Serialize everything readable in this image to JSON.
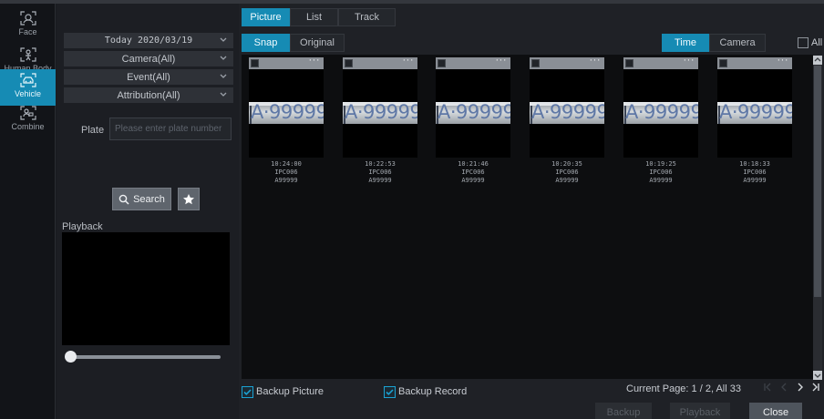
{
  "rail": [
    {
      "label": "Face",
      "icon": "face-scan-icon",
      "active": false
    },
    {
      "label": "Human Body",
      "icon": "human-body-icon",
      "active": false
    },
    {
      "label": "Vehicle",
      "icon": "vehicle-icon",
      "active": true
    },
    {
      "label": "Combine",
      "icon": "combine-icon",
      "active": false
    }
  ],
  "filters": {
    "date": "Today 2020/03/19",
    "camera": "Camera(All)",
    "event": "Event(All)",
    "attribution": "Attribution(All)",
    "plate_label": "Plate",
    "plate_placeholder": "Please enter plate number",
    "search_label": "Search",
    "playback_label": "Playback"
  },
  "tabs": [
    "Picture",
    "List",
    "Track"
  ],
  "subtabs": [
    "Snap",
    "Original"
  ],
  "sort": [
    "Time",
    "Camera"
  ],
  "all_label": "All",
  "results": [
    {
      "time": "10:24:00",
      "camera": "IPC006",
      "plate": "A99999",
      "plate_img": "A·99999"
    },
    {
      "time": "10:22:53",
      "camera": "IPC006",
      "plate": "A99999",
      "plate_img": "A·99999"
    },
    {
      "time": "10:21:46",
      "camera": "IPC006",
      "plate": "A99999",
      "plate_img": "A·99999"
    },
    {
      "time": "10:20:35",
      "camera": "IPC006",
      "plate": "A99999",
      "plate_img": "A·99999"
    },
    {
      "time": "10:19:25",
      "camera": "IPC006",
      "plate": "A99999",
      "plate_img": "A·99999"
    },
    {
      "time": "10:18:33",
      "camera": "IPC006",
      "plate": "A99999",
      "plate_img": "A·99999"
    }
  ],
  "footer": {
    "backup_picture": "Backup Picture",
    "backup_record": "Backup Record",
    "page_info": "Current Page: 1 / 2, All 33",
    "backup_btn": "Backup",
    "playback_btn": "Playback",
    "close_btn": "Close"
  },
  "colors": {
    "accent": "#168bb4",
    "background": "#191b20"
  }
}
